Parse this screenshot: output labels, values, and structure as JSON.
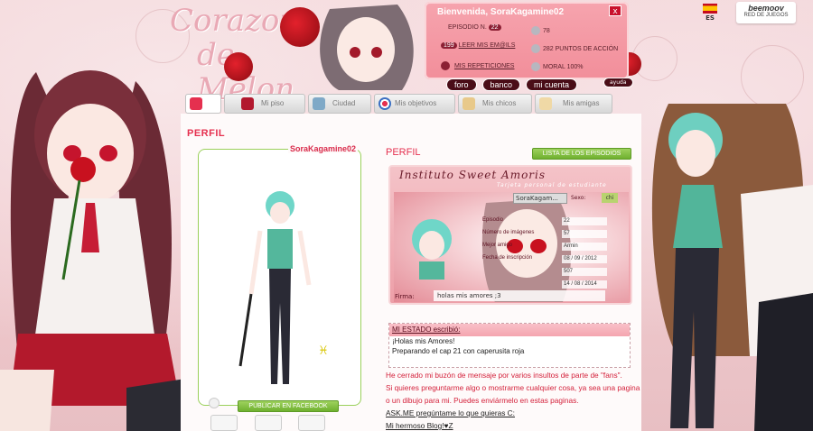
{
  "header": {
    "logo_line1": "Corazon",
    "logo_line2": "de Melon",
    "welcome": "Bienvenida, SoraKagamine02",
    "close_label": "x",
    "episode_label": "EPISODIO N.",
    "episode_value": "22",
    "stat_diamonds": "78",
    "mail_count": "199",
    "mail_label": "LEER MIS EM@ILS",
    "action_points": "282 PUNTOS DE ACCIÓN",
    "replays_label": "MIS REPETICIONES",
    "morale": "MORAL 100%",
    "language": "ES",
    "network_brand": "beemoov",
    "network_label": "RED DE JUEGOS",
    "nav_pills": [
      "foro",
      "banco",
      "mi cuenta"
    ],
    "help_label": "ayuda",
    "accent": "#e5304f"
  },
  "tabs": [
    {
      "label": "",
      "icon": "home-icon"
    },
    {
      "label": "Mi piso",
      "icon": "sofa-icon"
    },
    {
      "label": "Ciudad",
      "icon": "city-icon"
    },
    {
      "label": "Mis objetivos",
      "icon": "target-icon"
    },
    {
      "label": "Mis chicos",
      "icon": "boy-icon"
    },
    {
      "label": "Mis amigas",
      "icon": "girl-icon"
    }
  ],
  "profile": {
    "heading": "PERFIL",
    "username": "SoraKagamine02",
    "publish_button": "PUBLICAR EN FACEBOOK",
    "zodiac": "♓",
    "right_heading": "PERFIL",
    "episodes_button": "LISTA DE LOS EPISODIOS"
  },
  "card": {
    "title": "Instituto Sweet Amoris",
    "subtitle": "Tarjeta personal de estudiante",
    "name_value": "SoraKagam...",
    "sex_label": "Sexo:",
    "sex_value": "chi",
    "fields": [
      {
        "label": "Episodio",
        "value": "22"
      },
      {
        "label": "Número de imágenes",
        "value": "57"
      },
      {
        "label": "Mejor amigo",
        "value": "Armin"
      },
      {
        "label": "Fecha de inscripción",
        "value": "08 / 09 / 2012"
      },
      {
        "label": "",
        "value": "507"
      },
      {
        "label": "",
        "value": "14 / 08 / 2014"
      }
    ],
    "signature_label": "Firma:",
    "signature_value": "holas mis amores ;3"
  },
  "status": {
    "heading": "MI ESTADO escribió:",
    "lines": [
      "¡Holas mis Amores!",
      "Preparando el cap 21 con caperusita roja"
    ]
  },
  "bio": {
    "line1": "He cerrado mi buzón de mensaje por varios insultos de parte de \"fans\".",
    "line2": "Si quieres preguntarme algo o mostrarme cualquier cosa, ya sea una pagina o un dibujo para mi. Puedes enviármelo en estas paginas.",
    "line3": "ASK.ME pregúntame lo que quieras C:",
    "line4": "Mi hermoso Blog!♥Z"
  }
}
